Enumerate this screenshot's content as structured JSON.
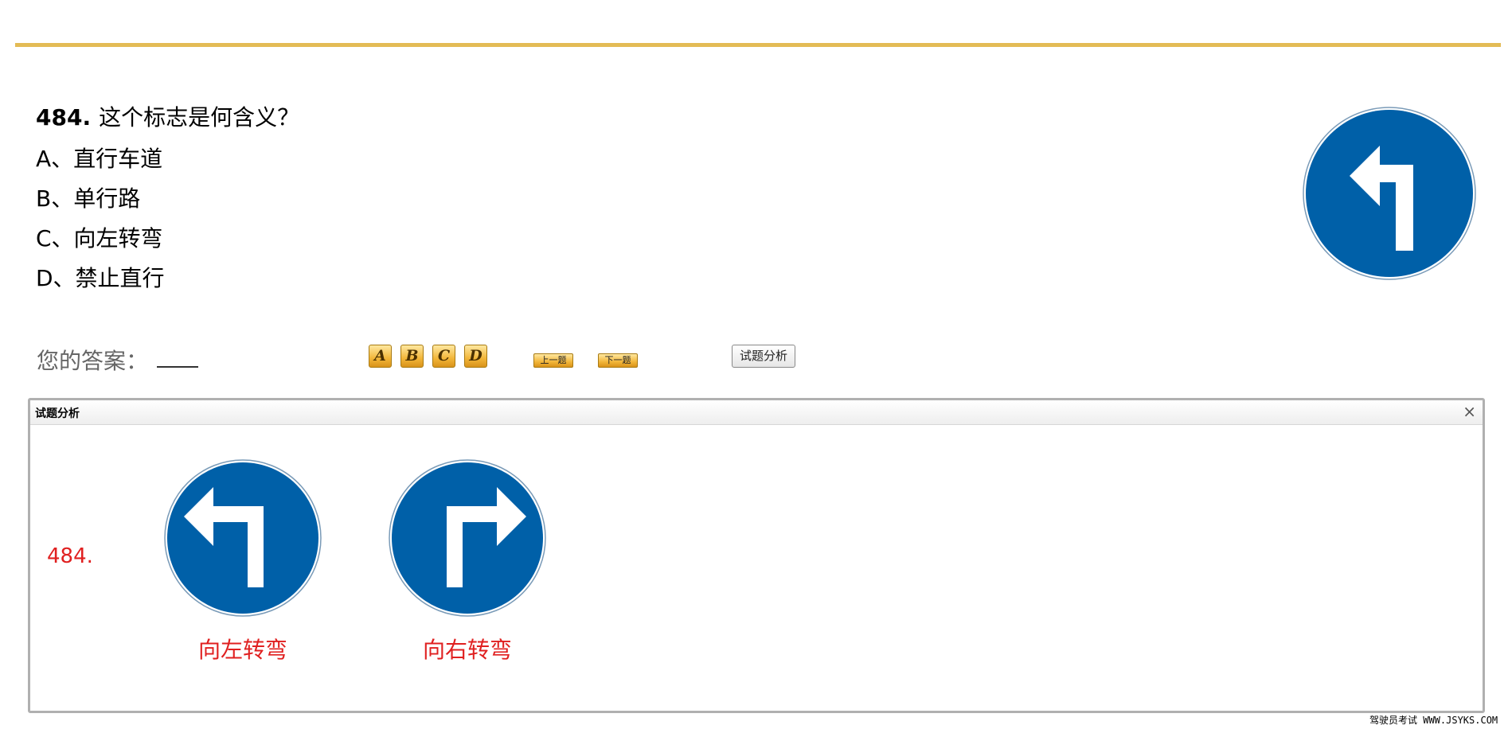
{
  "question": {
    "number": "484.",
    "text": "这个标志是何含义？",
    "options": [
      "A、直行车道",
      "B、单行路",
      "C、向左转弯",
      "D、禁止直行"
    ],
    "image_icon": "turn-left-sign-icon"
  },
  "answer": {
    "label": "您的答案：",
    "choices": [
      "A",
      "B",
      "C",
      "D"
    ],
    "prev_label": "上一题",
    "next_label": "下一题",
    "analysis_label": "试题分析"
  },
  "dialog": {
    "title": "试题分析",
    "close": "×",
    "number": "484.",
    "signs": [
      {
        "caption": "向左转弯",
        "icon": "turn-left-sign-icon"
      },
      {
        "caption": "向右转弯",
        "icon": "turn-right-sign-icon"
      }
    ]
  },
  "footer": "驾驶员考试 WWW.JSYKS.COM",
  "colors": {
    "accent_rule": "#e3bb55",
    "sign_blue": "#0060a8",
    "caption_red": "#e02020"
  }
}
